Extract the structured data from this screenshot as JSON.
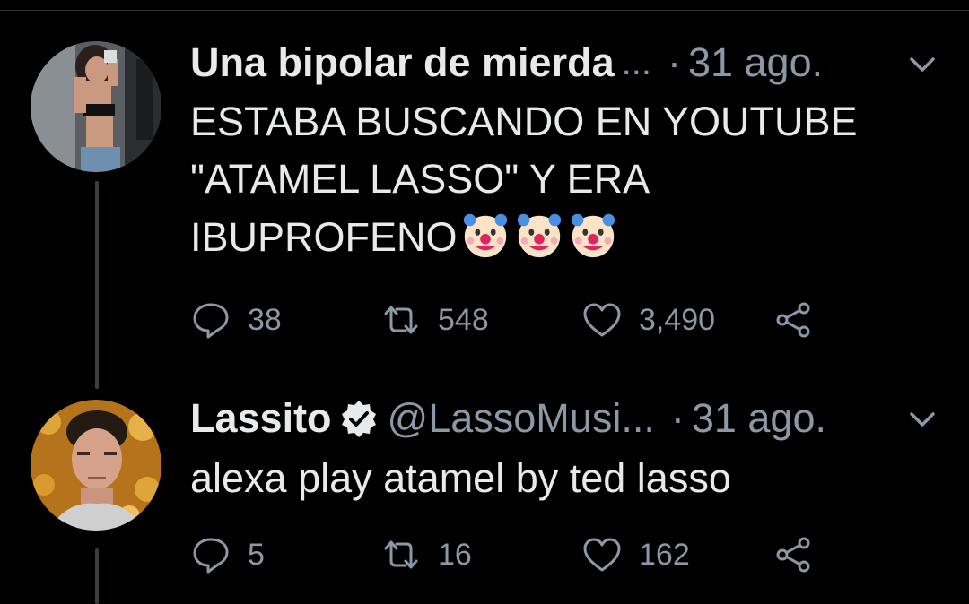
{
  "theme": {
    "background": "#000000",
    "text": "#e7e9ea",
    "muted": "#8b98a5",
    "thread_line": "#3b3f42"
  },
  "tweets": [
    {
      "display_name": "Una bipolar de mierda",
      "name_truncation": "...",
      "separator": "·",
      "date": "31 ago.",
      "text_lines": [
        "ESTABA BUSCANDO EN YOUTUBE",
        "\"ATAMEL LASSO\" Y ERA",
        "IBUPROFENO"
      ],
      "emoji": [
        "clown-face-emoji",
        "clown-face-emoji",
        "clown-face-emoji"
      ],
      "replies": "38",
      "retweets": "548",
      "likes": "3,490",
      "avatar_icon": "user-photo-avatar"
    },
    {
      "display_name": "Lassito",
      "verified": true,
      "handle": "@LassoMusi...",
      "separator": "·",
      "date": "31 ago.",
      "text_lines": [
        "alexa play atamel by ted lasso"
      ],
      "replies": "5",
      "retweets": "16",
      "likes": "162",
      "avatar_icon": "user-photo-avatar"
    }
  ]
}
